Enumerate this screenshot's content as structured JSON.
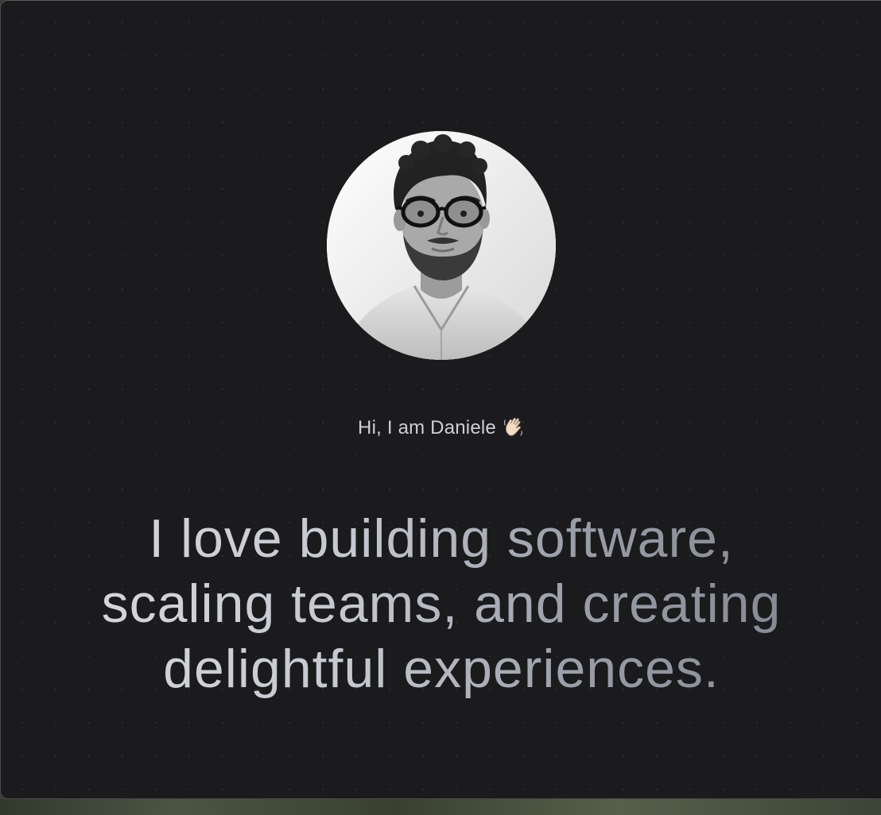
{
  "profile": {
    "greeting": "Hi, I am Daniele",
    "greeting_emoji_icon": "waving-hand-icon",
    "headline": "I love building software, scaling teams, and creating delightful experiences."
  },
  "colors": {
    "background": "#1b1b1e",
    "greeting_text": "#cfd0d4",
    "headline_start": "#d9dbe0",
    "headline_end": "#7d818a"
  }
}
